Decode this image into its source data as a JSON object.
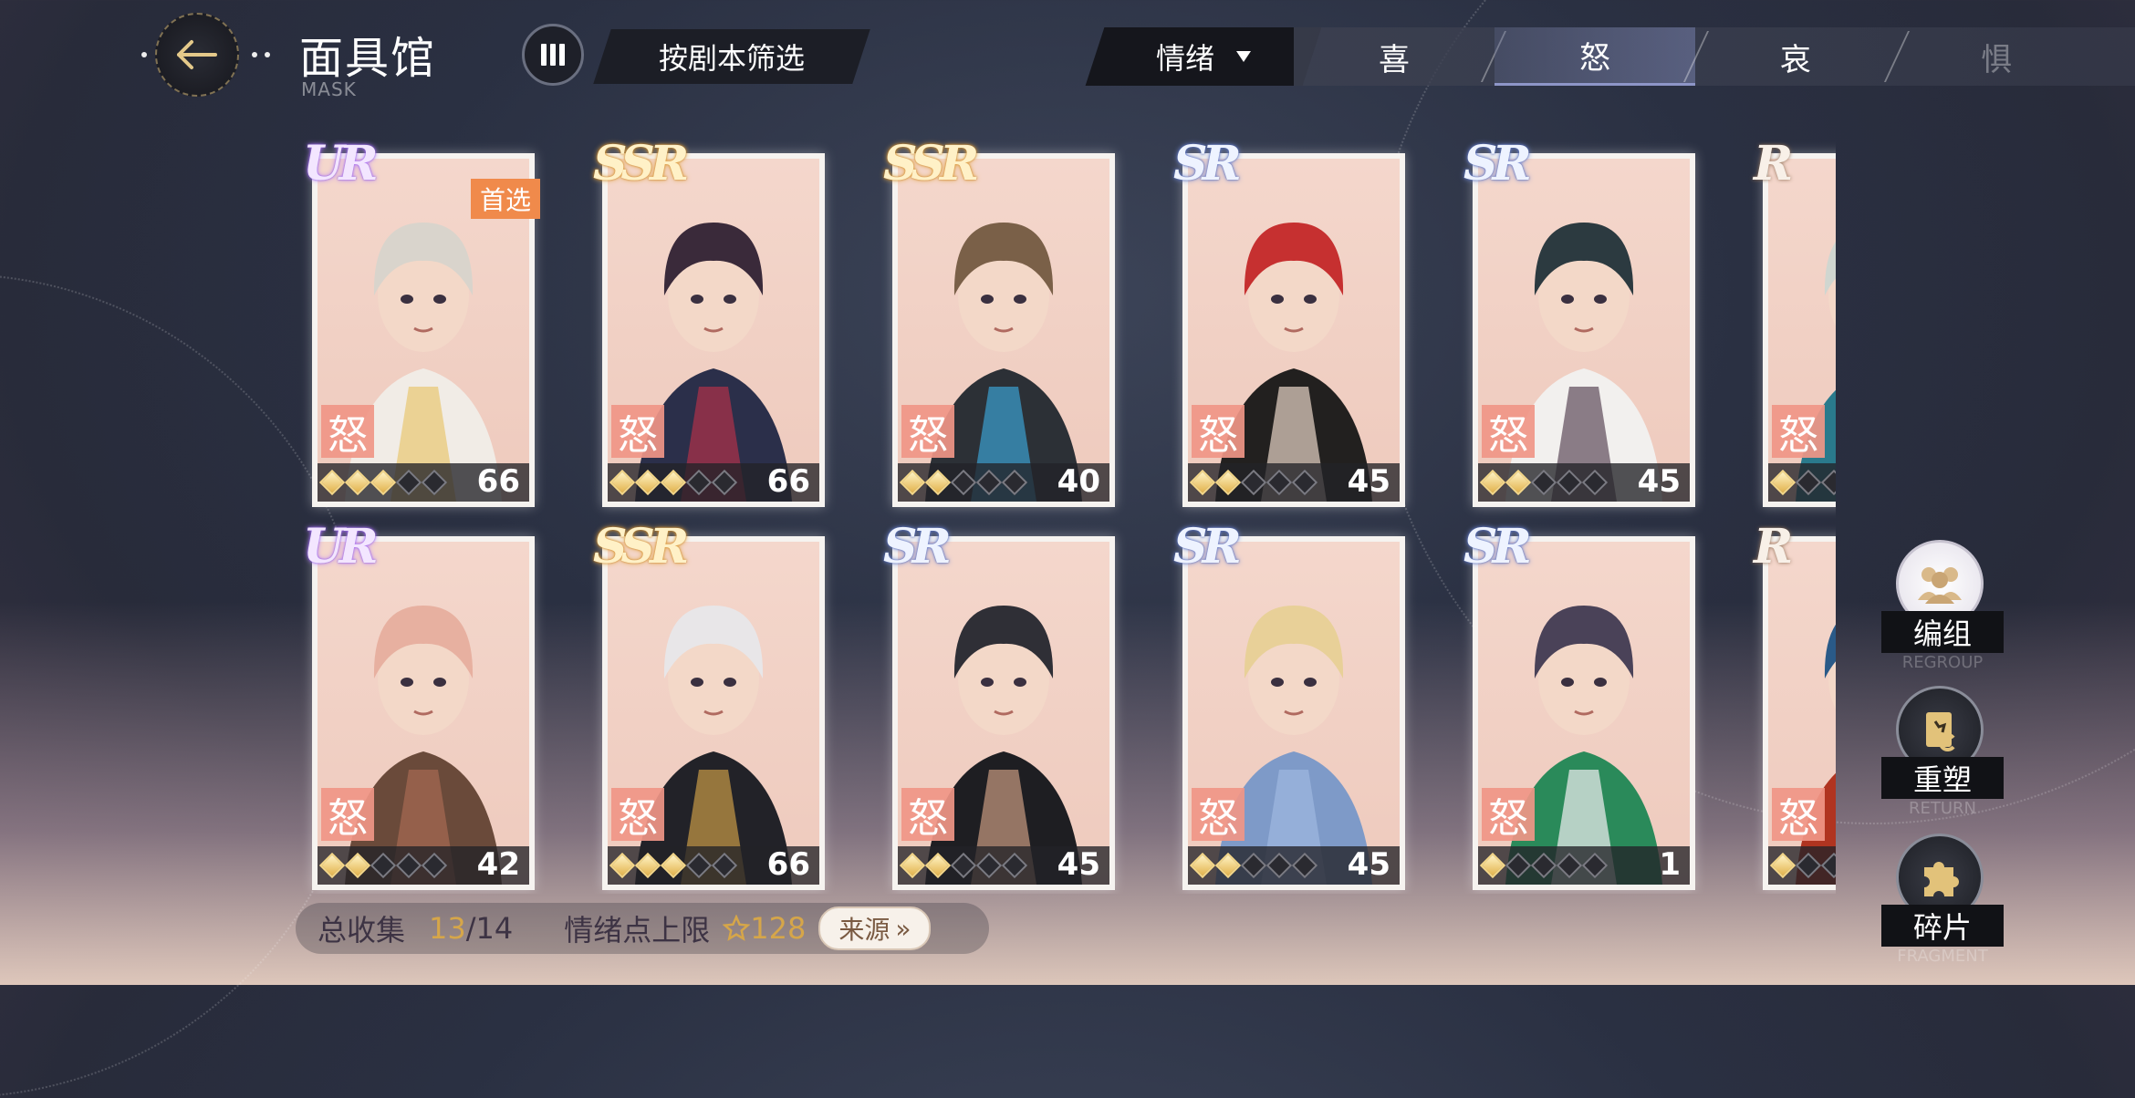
{
  "header": {
    "title": "面具馆",
    "subtitle": "MASK",
    "filter_label": "按剧本筛选"
  },
  "emotion_filter": {
    "selected": "情绪",
    "tabs": [
      "喜",
      "怒",
      "哀",
      "惧"
    ],
    "active_tab": "怒"
  },
  "cards": [
    {
      "rarity": "UR",
      "tag": "首选",
      "emotion": "怒",
      "stars_filled": 3,
      "stars_total": 5,
      "level": "66"
    },
    {
      "rarity": "SSR",
      "tag": "",
      "emotion": "怒",
      "stars_filled": 3,
      "stars_total": 5,
      "level": "66"
    },
    {
      "rarity": "SSR",
      "tag": "",
      "emotion": "怒",
      "stars_filled": 2,
      "stars_total": 5,
      "level": "40"
    },
    {
      "rarity": "SR",
      "tag": "",
      "emotion": "怒",
      "stars_filled": 2,
      "stars_total": 5,
      "level": "45"
    },
    {
      "rarity": "SR",
      "tag": "",
      "emotion": "怒",
      "stars_filled": 2,
      "stars_total": 5,
      "level": "45"
    },
    {
      "rarity": "R",
      "tag": "",
      "emotion": "怒",
      "stars_filled": 1,
      "stars_total": 5,
      "level": ""
    },
    {
      "rarity": "UR",
      "tag": "",
      "emotion": "怒",
      "stars_filled": 2,
      "stars_total": 5,
      "level": "42"
    },
    {
      "rarity": "SSR",
      "tag": "",
      "emotion": "怒",
      "stars_filled": 3,
      "stars_total": 5,
      "level": "66"
    },
    {
      "rarity": "SR",
      "tag": "",
      "emotion": "怒",
      "stars_filled": 2,
      "stars_total": 5,
      "level": "45"
    },
    {
      "rarity": "SR",
      "tag": "",
      "emotion": "怒",
      "stars_filled": 2,
      "stars_total": 5,
      "level": "45"
    },
    {
      "rarity": "SR",
      "tag": "",
      "emotion": "怒",
      "stars_filled": 1,
      "stars_total": 5,
      "level": "1"
    },
    {
      "rarity": "R",
      "tag": "",
      "emotion": "怒",
      "stars_filled": 1,
      "stars_total": 5,
      "level": ""
    }
  ],
  "side_buttons": [
    {
      "label": "编组",
      "sublabel": "REGROUP",
      "icon": "group-icon"
    },
    {
      "label": "重塑",
      "sublabel": "RETURN",
      "icon": "reshape-card-icon"
    },
    {
      "label": "碎片",
      "sublabel": "FRAGMENT",
      "icon": "puzzle-piece-icon"
    }
  ],
  "stats": {
    "collection_label": "总收集",
    "collected": "13",
    "total": "/14",
    "emotion_cap_label": "情绪点上限",
    "emotion_cap": "128",
    "source_button": "来源"
  },
  "colors": {
    "accent_gold": "#d6a649",
    "emotion_badge": "#f0968a",
    "first_pick": "#f08a4b"
  }
}
